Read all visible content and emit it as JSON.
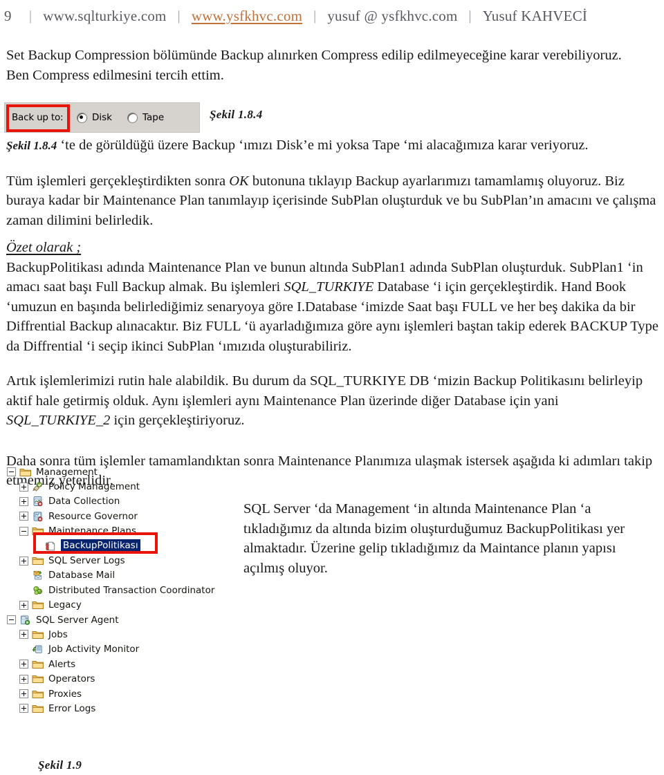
{
  "header": {
    "page_number": "9",
    "separator": "|",
    "site": "www.sqlturkiye.com",
    "link": "www.ysfkhvc.com",
    "email": "yusuf @ ysfkhvc.com",
    "author": "Yusuf KAHVECİ",
    "link_color": "#c2703a"
  },
  "body": {
    "p1_line1": "Set Backup Compression bölümünde Backup alınırken Compress edilip edilmeyeceğine karar verebiliyoruz.",
    "p1_line2": "Ben Compress edilmesini tercih ettim.",
    "p2_fig_ref": "Şekil 1.8.4",
    "p2_rest": "‘te de görüldüğü üzere Backup ‘ımızı Disk’e mi yoksa Tape ‘mi alacağımıza karar veriyoruz.",
    "p3_a": "Tüm işlemleri gerçekleştirdikten sonra ",
    "p3_ok": "OK",
    "p3_b": " butonuna tıklayıp Backup ayarlarımızı tamamlamış oluyoruz. Biz buraya kadar bir Maintenance Plan tanımlayıp içerisinde SubPlan oluşturduk ve bu SubPlan’ın amacını ve çalışma zaman dilimini belirledik.",
    "summary_heading": "Özet olarak ;",
    "p4_a": "BackupPolitikası adında Maintenance Plan ve bunun altında SubPlan1 adında SubPlan oluşturduk. SubPlan1 ‘in amacı saat başı Full Backup almak. Bu işlemleri ",
    "p4_db1": "SQL_TURKIYE",
    "p4_b": " Database ‘i için gerçekleştirdik. Hand Book ‘umuzun en başında belirlediğimiz senaryoya göre I.Database ‘imizde Saat başı FULL ve her beş dakika da bir Diffrential Backup alınacaktır. Biz FULL ‘ü ayarladığımıza göre aynı işlemleri baştan  takip ederek BACKUP Type da Diffrential ‘i seçip ikinci SubPlan ‘ımızıda oluşturabiliriz.",
    "p5_a": "Artık işlemlerimizi rutin hale alabildik. Bu durum da SQL_TURKIYE DB ‘mizin Backup Politikasını belirleyip aktif hale getirmiş olduk. Aynı işlemleri aynı Maintenance Plan üzerinde diğer Database için yani ",
    "p5_db2": "SQL_TURKIYE_2",
    "p5_b": " için gerçekleştiriyoruz.",
    "p6": "Daha sonra tüm işlemler tamamlandıktan sonra Maintenance Planımıza ulaşmak istersek aşağıda ki adımları takip etmemiz yeterlidir."
  },
  "figure_backup": {
    "label": "Back up to:",
    "options": [
      {
        "text": "Disk",
        "selected": true
      },
      {
        "text": "Tape",
        "selected": false
      }
    ],
    "caption": "Şekil 1.8.4",
    "highlight_color": "#e8140a",
    "panel_color": "#d6d3ce"
  },
  "tree": {
    "selection_color": "#09246e",
    "highlight_color": "#e8140a",
    "items": [
      {
        "label": "Management",
        "depth": 0,
        "toggle": "minus",
        "icon": "folder-icon",
        "selected": false
      },
      {
        "label": "Policy Management",
        "depth": 1,
        "toggle": "plus",
        "icon": "policy-management-icon",
        "selected": false
      },
      {
        "label": "Data Collection",
        "depth": 1,
        "toggle": "plus",
        "icon": "data-collection-icon",
        "selected": false
      },
      {
        "label": "Resource Governor",
        "depth": 1,
        "toggle": "plus",
        "icon": "resource-governor-icon",
        "selected": false
      },
      {
        "label": "Maintenance Plans",
        "depth": 1,
        "toggle": "minus",
        "icon": "folder-icon",
        "selected": false
      },
      {
        "label": "BackupPolitikası",
        "depth": 2,
        "toggle": "none",
        "icon": "maintenance-plan-icon",
        "selected": true
      },
      {
        "label": "SQL Server Logs",
        "depth": 1,
        "toggle": "plus",
        "icon": "folder-icon",
        "selected": false
      },
      {
        "label": "Database Mail",
        "depth": 1,
        "toggle": "none",
        "icon": "database-mail-icon",
        "selected": false
      },
      {
        "label": "Distributed Transaction Coordinator",
        "depth": 1,
        "toggle": "none",
        "icon": "dtc-icon",
        "selected": false
      },
      {
        "label": "Legacy",
        "depth": 1,
        "toggle": "plus",
        "icon": "folder-icon",
        "selected": false
      },
      {
        "label": "SQL Server Agent",
        "depth": 0,
        "toggle": "minus",
        "icon": "sql-server-agent-icon",
        "selected": false
      },
      {
        "label": "Jobs",
        "depth": 1,
        "toggle": "plus",
        "icon": "folder-icon",
        "selected": false
      },
      {
        "label": "Job Activity Monitor",
        "depth": 1,
        "toggle": "none",
        "icon": "job-activity-monitor-icon",
        "selected": false
      },
      {
        "label": "Alerts",
        "depth": 1,
        "toggle": "plus",
        "icon": "folder-icon",
        "selected": false
      },
      {
        "label": "Operators",
        "depth": 1,
        "toggle": "plus",
        "icon": "folder-icon",
        "selected": false
      },
      {
        "label": "Proxies",
        "depth": 1,
        "toggle": "plus",
        "icon": "folder-icon",
        "selected": false
      },
      {
        "label": "Error Logs",
        "depth": 1,
        "toggle": "plus",
        "icon": "folder-icon",
        "selected": false
      }
    ]
  },
  "side_note": {
    "text": "SQL Server ‘da Management ‘in altında Maintenance Plan ‘a tıkladığımız da altında bizim oluşturduğumuz BackupPolitikası yer almaktadır. Üzerine gelip tıkladığımız da Maintance planın yapısı açılmış oluyor."
  },
  "figure_caption_bottom": "Şekil 1.9"
}
